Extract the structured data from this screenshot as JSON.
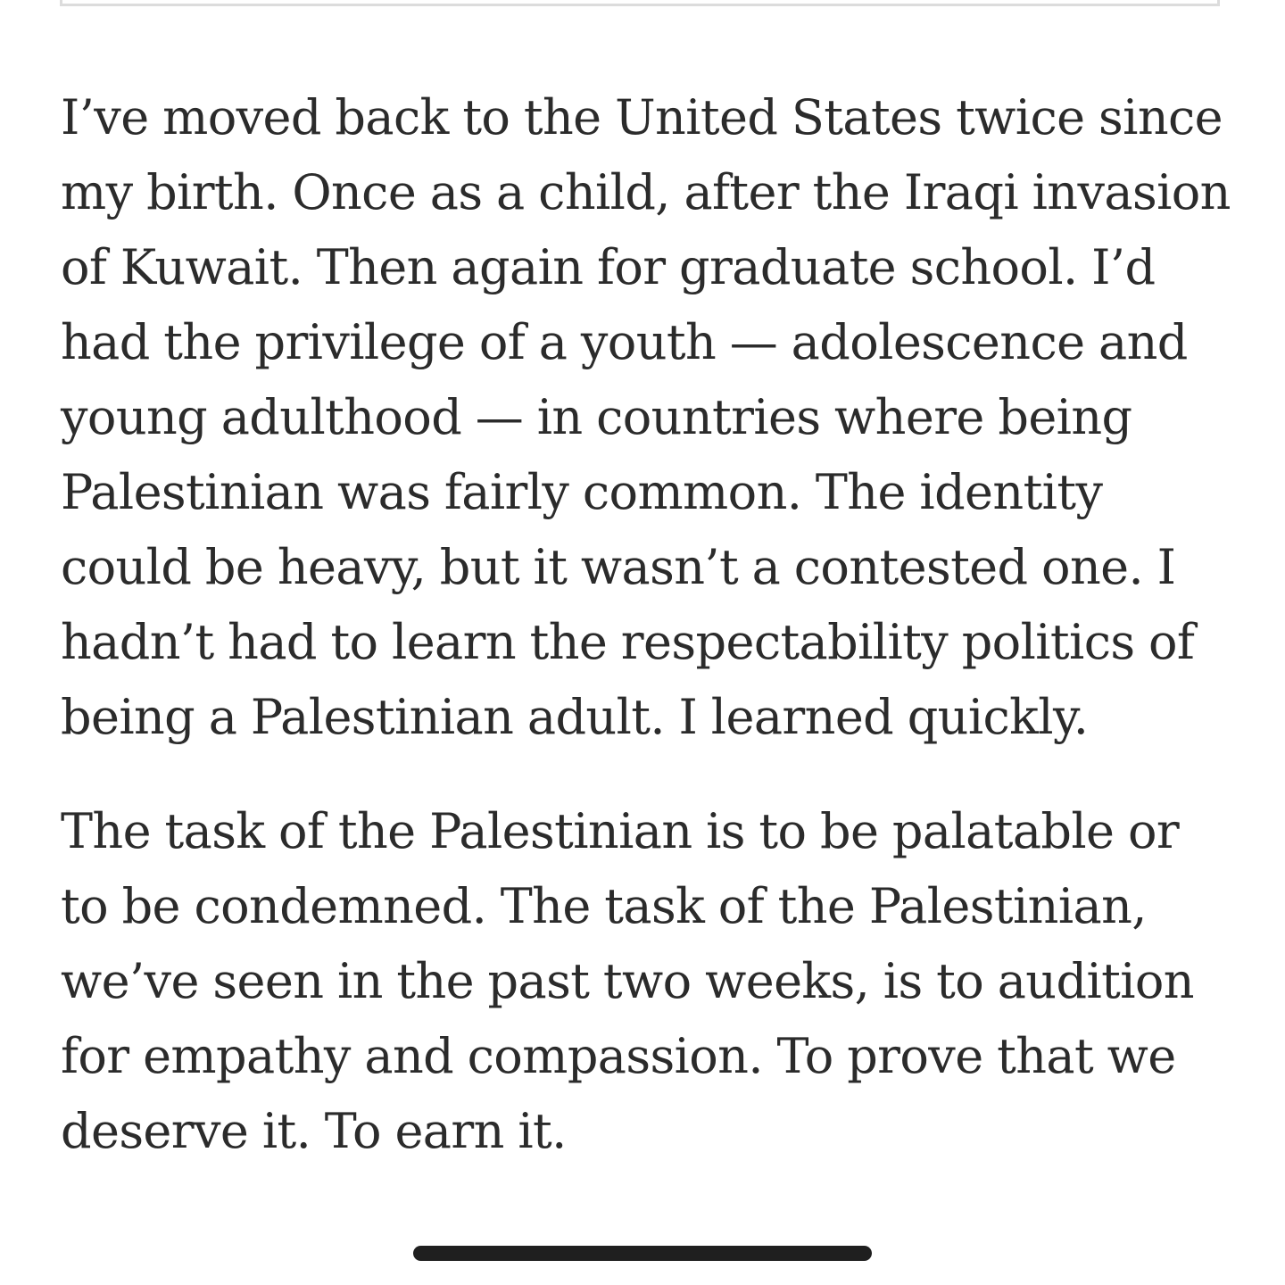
{
  "article": {
    "paragraphs": [
      "I’ve moved back to the United States twice since my birth. Once as a child, after the Iraqi invasion of Kuwait. Then again for graduate school. I’d had the privilege of a youth — adolescence and young adulthood — in countries where being Palestinian was fairly common. The identity could be heavy, but it wasn’t a contested one. I hadn’t had to learn the respectability politics of being a Palestinian adult. I learned quickly.",
      "The task of the Palestinian is to be palatable or to be condemned. The task of the Palestinian, we’ve seen in the past two weeks, is to audition for empathy and compassion. To prove that we deserve it. To earn it."
    ]
  },
  "colors": {
    "text": "#2b2b2b",
    "background": "#ffffff",
    "divider": "#dcdcdc",
    "home_indicator": "#1f1f1f"
  }
}
